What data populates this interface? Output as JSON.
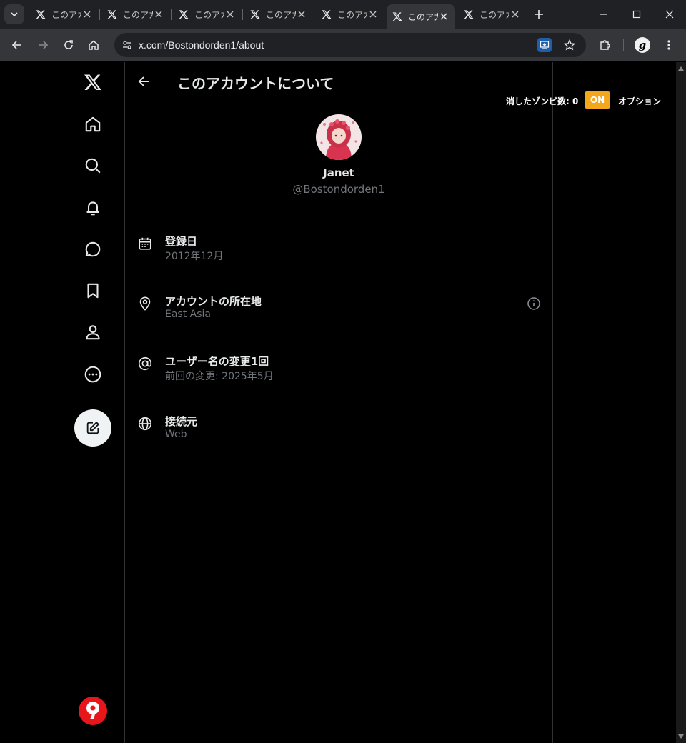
{
  "browser": {
    "tabs": [
      {
        "label": "このアカウントについて",
        "active": false
      },
      {
        "label": "このアカウントについて",
        "active": false
      },
      {
        "label": "このアカウントについて",
        "active": false
      },
      {
        "label": "このアカウントについて",
        "active": false
      },
      {
        "label": "このアカウントについて",
        "active": false
      },
      {
        "label": "このアカウントについて",
        "active": true
      },
      {
        "label": "このアカウントについて",
        "active": false
      }
    ],
    "url": "x.com/Bostondorden1/about",
    "extension_letter": "g"
  },
  "nav": {
    "items": [
      "x-logo-icon",
      "home-icon",
      "search-icon",
      "bell-icon",
      "message-icon",
      "bookmark-icon",
      "profile-icon",
      "more-icon"
    ]
  },
  "header": {
    "title": "このアカウントについて"
  },
  "profile": {
    "name": "Janet",
    "handle": "@Bostondorden1"
  },
  "info_rows": [
    {
      "title": "登録日",
      "value": "2012年12月",
      "icon": "calendar-icon"
    },
    {
      "title": "アカウントの所在地",
      "value": "East Asia",
      "icon": "location-icon"
    },
    {
      "title": "ユーザー名の変更1回",
      "value": "前回の変更: 2025年5月",
      "icon": "at-sign-icon"
    },
    {
      "title": "接続元",
      "value": "Web",
      "icon": "globe-icon"
    }
  ],
  "zombie": {
    "label": "消したゾンビ数: 0",
    "toggle": "ON",
    "options": "オプション",
    "toggle_color": "#f4a71d"
  },
  "colors": {
    "background": "#000000",
    "text_primary": "#e7e9ea",
    "text_secondary": "#71767b",
    "bottom_logo": "#e8151b"
  }
}
